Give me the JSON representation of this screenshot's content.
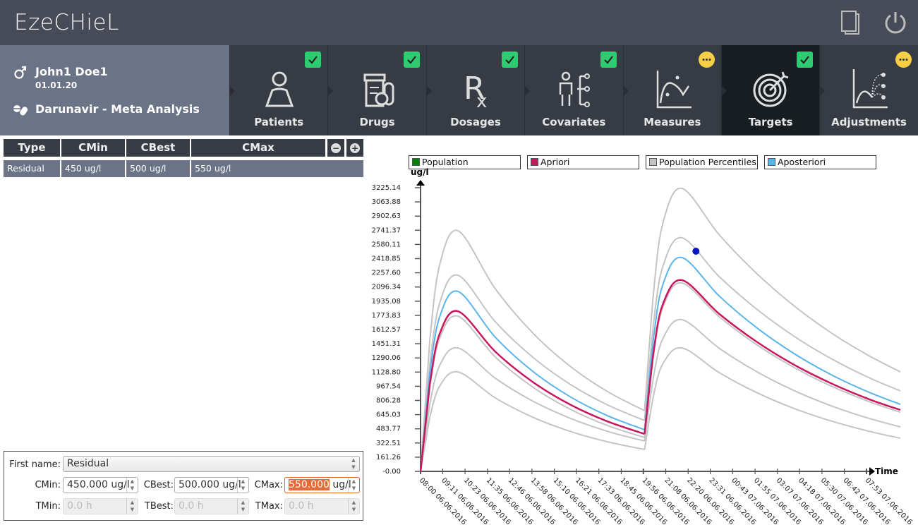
{
  "app": {
    "title": "EzeCHieL",
    "icons": [
      "documents-icon",
      "power-icon"
    ]
  },
  "patient": {
    "name": "John1 Doe1",
    "birthdate": "01.01.20",
    "drug": "Darunavir - Meta Analysis"
  },
  "tabs": [
    {
      "label": "Patients",
      "status": "done",
      "icon": "patient-icon"
    },
    {
      "label": "Drugs",
      "status": "done",
      "icon": "drugs-icon"
    },
    {
      "label": "Dosages",
      "status": "done",
      "icon": "rx-icon"
    },
    {
      "label": "Covariates",
      "status": "done",
      "icon": "covariates-icon"
    },
    {
      "label": "Measures",
      "status": "pending",
      "icon": "measures-icon"
    },
    {
      "label": "Targets",
      "status": "done",
      "icon": "target-icon",
      "active": true
    },
    {
      "label": "Adjustments",
      "status": "pending",
      "icon": "adjustments-icon"
    }
  ],
  "targets_table": {
    "columns": [
      "Type",
      "CMin",
      "CBest",
      "CMax"
    ],
    "rows": [
      {
        "type": "Residual",
        "cmin": "450 ug/l",
        "cbest": "500 ug/l",
        "cmax": "550 ug/l"
      }
    ]
  },
  "form": {
    "type_label": "First name:",
    "type_value": "Residual",
    "cmin_label": "CMin:",
    "cmin_value": "450.000 ug/l",
    "cbest_label": "CBest:",
    "cbest_value": "500.000 ug/l",
    "cmax_label": "CMax:",
    "cmax_value_selected": "550.000",
    "cmax_unit": " ug/l",
    "tmin_label": "TMin:",
    "tmin_value": "0.0 h",
    "tbest_label": "TBest:",
    "tbest_value": "0.0 h",
    "tmax_label": "TMax:",
    "tmax_value": "0.0 h"
  },
  "colors": {
    "done": "#2ecc71",
    "pending": "#f7cf45",
    "header": "#464b57",
    "panel": "#6b7386",
    "tab": "#373b44",
    "tab_active": "#171d20"
  },
  "chart_data": {
    "type": "line",
    "ylabel": "ug/l",
    "xlabel": "Time",
    "ylim": [
      0,
      3225.14
    ],
    "yticks": [
      "-0.00",
      "161.26",
      "322.51",
      "483.77",
      "645.03",
      "806.28",
      "967.54",
      "1128.80",
      "1290.06",
      "1451.31",
      "1612.57",
      "1773.83",
      "1935.08",
      "2096.34",
      "2257.60",
      "2418.85",
      "2580.11",
      "2741.37",
      "2902.63",
      "3063.88",
      "3225.14"
    ],
    "xticks": [
      "08:00 06.06.2016",
      "09:11 06.06.2016",
      "10:23 06.06.2016",
      "11:35 06.06.2016",
      "12:46 06.06.2016",
      "13:58 06.06.2016",
      "15:10 06.06.2016",
      "16:21 06.06.2016",
      "17:33 06.06.2016",
      "18:45 06.06.2016",
      "19:56 06.06.2016",
      "21:08 06.06.2016",
      "22:20 06.06.2016",
      "23:31 06.06.2016",
      "00:43 07.06.2016",
      "01:55 07.06.2016",
      "03:07 07.06.2016",
      "04:18 07.06.2016",
      "05:30 07.06.2016",
      "06:42 07.06.2016",
      "07:53 07.06.2016"
    ],
    "legend": [
      {
        "name": "Population",
        "color": "#0a7d0a"
      },
      {
        "name": "Apriori",
        "color": "#c8175f"
      },
      {
        "name": "Population Percentiles",
        "color": "#c4c4c4"
      },
      {
        "name": "Aposteriori",
        "color": "#5ab4ec"
      }
    ],
    "legend_placement": "top",
    "x": [
      "08:00 06.06.2016",
      "08:30 06.06.2016",
      "09:00 06.06.2016",
      "10:00 06.06.2016",
      "12:00 06.06.2016",
      "14:00 06.06.2016",
      "16:00 06.06.2016",
      "18:00 06.06.2016",
      "20:00 06.06.2016",
      "20:30 06.06.2016",
      "21:00 06.06.2016",
      "22:00 06.06.2016",
      "00:00 07.06.2016",
      "02:00 07.06.2016",
      "04:00 07.06.2016",
      "06:00 07.06.2016",
      "08:00 07.06.2016",
      "09:42 07.06.2016"
    ],
    "series": [
      {
        "group": "Population Percentiles",
        "color": "#c4c4c4",
        "values": [
          0,
          1505,
          2326,
          2736,
          2077,
          1576,
          1197,
          909,
          690,
          2080,
          2838,
          3217,
          2689,
          2251,
          1883,
          1574,
          1317,
          1131
        ]
      },
      {
        "group": "Population Percentiles",
        "color": "#c4c4c4",
        "values": [
          0,
          1227,
          1896,
          2230,
          1702,
          1300,
          992,
          757,
          578,
          1721,
          2344,
          2656,
          2213,
          1845,
          1537,
          1281,
          1067,
          915
        ]
      },
      {
        "group": "Population Percentiles",
        "color": "#c4c4c4",
        "values": [
          0,
          971,
          1500,
          1765,
          1301,
          960,
          708,
          522,
          385,
          1351,
          1878,
          2142,
          1757,
          1441,
          1182,
          969,
          795,
          672
        ]
      },
      {
        "group": "Population Percentiles",
        "color": "#c4c4c4",
        "values": [
          0,
          772,
          1193,
          1404,
          1060,
          800,
          605,
          456,
          345,
          1104,
          1518,
          1725,
          1399,
          1134,
          919,
          745,
          604,
          505
        ]
      },
      {
        "group": "Population Percentiles",
        "color": "#c4c4c4",
        "values": [
          0,
          622,
          961,
          1131,
          836,
          617,
          456,
          337,
          249,
          884,
          1231,
          1404,
          1122,
          896,
          716,
          572,
          457,
          377
        ]
      },
      {
        "group": "Aposteriori",
        "color": "#5ab4ec",
        "values": [
          0,
          1125,
          1740,
          2046,
          1526,
          1139,
          850,
          634,
          473,
          1550,
          2137,
          2431,
          1993,
          1634,
          1340,
          1098,
          901,
          762
        ]
      },
      {
        "group": "Apriori",
        "color": "#c8175f",
        "values": [
          0,
          1000,
          1550,
          1821,
          1362,
          1018,
          761,
          569,
          425,
          1387,
          1912,
          2174,
          1790,
          1474,
          1213,
          1000,
          822,
          698
        ]
      }
    ],
    "measures": [
      {
        "x": "22:45 06.06.2016",
        "y": 2503,
        "color": "#0a14c8"
      }
    ]
  }
}
